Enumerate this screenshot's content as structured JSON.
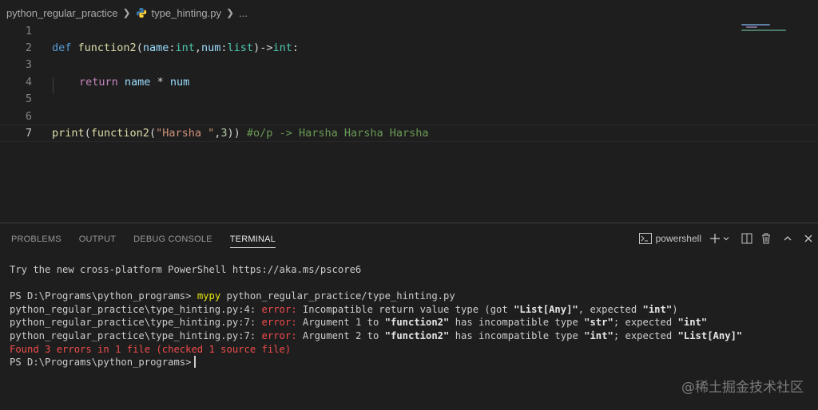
{
  "breadcrumb": {
    "folder": "python_regular_practice",
    "file": "type_hinting.py",
    "more": "..."
  },
  "editor": {
    "line_numbers": [
      "1",
      "2",
      "3",
      "4",
      "5",
      "6",
      "7"
    ],
    "line2": {
      "def": "def",
      "fname": "function2",
      "open": "(",
      "p1": "name",
      "c1": ":",
      "t1": "int",
      "comma": ",",
      "p2": "num",
      "c2": ":",
      "t2": "list",
      "close": ")",
      "arrow": "->",
      "rt": "int",
      "colon": ":"
    },
    "line4": {
      "ret": "return",
      "a": "name",
      "op": " * ",
      "b": "num"
    },
    "line7": {
      "print": "print",
      "open": "(",
      "fname": "function2",
      "open2": "(",
      "str": "\"Harsha \"",
      "comma": ",",
      "num": "3",
      "close": "))",
      "comment": "#o/p -> Harsha Harsha Harsha"
    }
  },
  "panel": {
    "tabs": [
      "PROBLEMS",
      "OUTPUT",
      "DEBUG CONSOLE",
      "TERMINAL"
    ],
    "active_tab": "TERMINAL",
    "shell_label": "powershell"
  },
  "terminal": {
    "intro": "Try the new cross-platform PowerShell https://aka.ms/pscore6",
    "prompt": "PS D:\\Programs\\python_programs>",
    "cmd": "mypy",
    "cmd_arg": "python_regular_practice/type_hinting.py",
    "errors": [
      {
        "loc": "python_regular_practice\\type_hinting.py:4:",
        "label": "error:",
        "pre": "Incompatible return value type (got ",
        "b1": "\"List[Any]\"",
        "mid": ", expected ",
        "b2": "\"int\"",
        "end": ")"
      },
      {
        "loc": "python_regular_practice\\type_hinting.py:7:",
        "label": "error:",
        "pre": "Argument 1 to ",
        "b1": "\"function2\"",
        "mid": " has incompatible type ",
        "b2": "\"str\"",
        "mid2": "; expected ",
        "b3": "\"int\""
      },
      {
        "loc": "python_regular_practice\\type_hinting.py:7:",
        "label": "error:",
        "pre": "Argument 2 to ",
        "b1": "\"function2\"",
        "mid": " has incompatible type ",
        "b2": "\"int\"",
        "mid2": "; expected ",
        "b3": "\"List[Any]\""
      }
    ],
    "summary": "Found 3 errors in 1 file (checked 1 source file)",
    "final_prompt": "PS D:\\Programs\\python_programs>"
  },
  "watermark": "@稀土掘金技术社区",
  "icons": [
    "python-file-icon",
    "terminal-icon",
    "plus-icon",
    "chevron-down-icon",
    "split-icon",
    "trash-icon",
    "chevron-up-icon",
    "close-icon"
  ],
  "colors": {
    "background": "#1e1e1e",
    "keyword": "#569cd6",
    "function": "#dcdcaa",
    "param": "#9cdcfe",
    "type": "#4ec9b0",
    "string": "#ce9178",
    "comment": "#6a9955",
    "error": "#f14c4c",
    "command": "#e5e510"
  }
}
